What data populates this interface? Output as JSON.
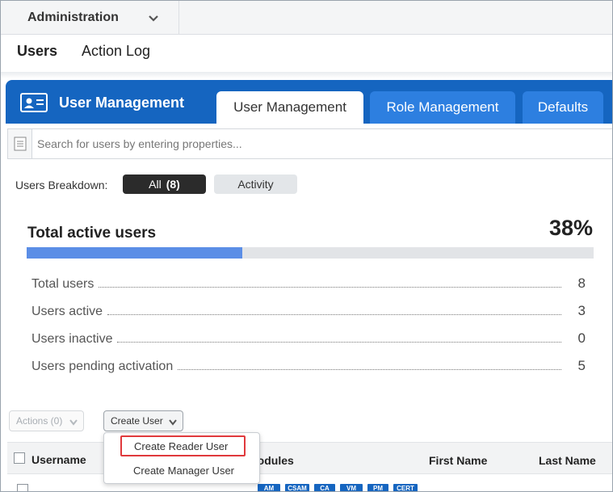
{
  "topbar": {
    "module_label": "Administration"
  },
  "subnav": {
    "items": [
      {
        "label": "Users"
      },
      {
        "label": "Action Log"
      }
    ]
  },
  "header": {
    "app_title": "User Management",
    "tabs": [
      {
        "label": "User Management"
      },
      {
        "label": "Role Management"
      },
      {
        "label": "Defaults"
      }
    ]
  },
  "search": {
    "placeholder": "Search for users by entering properties..."
  },
  "breakdown": {
    "label": "Users Breakdown:",
    "all_label": "All",
    "all_count": "(8)",
    "activity_label": "Activity"
  },
  "summary": {
    "title": "Total active users",
    "percent_text": "38%",
    "progress_fraction": 0.38,
    "stats": [
      {
        "label": "Total users",
        "value": "8"
      },
      {
        "label": "Users active",
        "value": "3"
      },
      {
        "label": "Users inactive",
        "value": "0"
      },
      {
        "label": "Users pending activation",
        "value": "5"
      }
    ]
  },
  "actions": {
    "actions_label": "Actions (0)",
    "create_label": "Create User"
  },
  "create_menu": {
    "items": [
      {
        "label": "Create Reader User"
      },
      {
        "label": "Create Manager User"
      }
    ]
  },
  "table": {
    "columns": [
      {
        "label": "Username"
      },
      {
        "label": "Modules"
      },
      {
        "label": "First Name"
      },
      {
        "label": "Last Name"
      }
    ],
    "module_badges": [
      "AM",
      "CSAM",
      "CA",
      "VM",
      "PM",
      "CERT"
    ]
  },
  "colors": {
    "brand_blue": "#1565c0",
    "tab_blue": "#2d7fe0",
    "progress_blue": "#5b8ee6",
    "highlight_red": "#e0393c"
  }
}
